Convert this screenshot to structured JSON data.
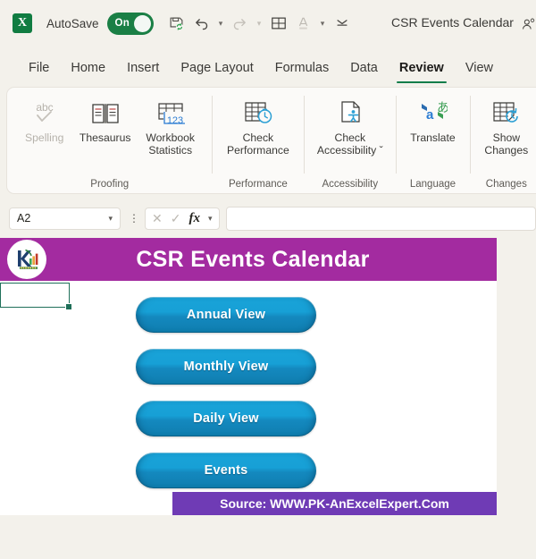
{
  "titlebar": {
    "app_icon": "excel-icon",
    "app_letter": "X",
    "autosave_label": "AutoSave",
    "autosave_state": "On",
    "doc_title": "CSR Events Calendar",
    "qat": [
      {
        "name": "save-icon",
        "label": "Save"
      },
      {
        "name": "undo-icon",
        "label": "Undo"
      },
      {
        "name": "redo-icon",
        "label": "Redo"
      },
      {
        "name": "borders-icon",
        "label": "Borders"
      },
      {
        "name": "font-color-icon",
        "label": "Font Color"
      },
      {
        "name": "customize-quick-access-toolbar-icon",
        "label": "Customize Quick Access Toolbar"
      }
    ],
    "share_icon": "share-person-icon"
  },
  "tabs": [
    {
      "label": "File",
      "active": false
    },
    {
      "label": "Home",
      "active": false
    },
    {
      "label": "Insert",
      "active": false
    },
    {
      "label": "Page Layout",
      "active": false
    },
    {
      "label": "Formulas",
      "active": false
    },
    {
      "label": "Data",
      "active": false
    },
    {
      "label": "Review",
      "active": true
    },
    {
      "label": "View",
      "active": false
    }
  ],
  "ribbon": {
    "groups": [
      {
        "name": "Proofing",
        "buttons": [
          {
            "label": "Spelling",
            "icon": "spelling-abc-check-icon",
            "disabled": true
          },
          {
            "label": "Thesaurus",
            "icon": "thesaurus-book-icon",
            "disabled": false
          },
          {
            "label": "Workbook Statistics",
            "icon": "workbook-statistics-icon",
            "disabled": false
          }
        ]
      },
      {
        "name": "Performance",
        "buttons": [
          {
            "label": "Check Performance",
            "icon": "check-performance-icon",
            "disabled": false
          }
        ]
      },
      {
        "name": "Accessibility",
        "buttons": [
          {
            "label": "Check Accessibility ˇ",
            "icon": "check-accessibility-icon",
            "disabled": false
          }
        ]
      },
      {
        "name": "Language",
        "buttons": [
          {
            "label": "Translate",
            "icon": "translate-icon",
            "disabled": false
          }
        ]
      },
      {
        "name": "Changes",
        "buttons": [
          {
            "label": "Show Changes",
            "icon": "show-changes-icon",
            "disabled": false
          }
        ]
      }
    ]
  },
  "formula_bar": {
    "name_box_value": "A2",
    "cancel_icon": "cancel-x-icon",
    "enter_icon": "enter-check-icon",
    "fx_label": "fx",
    "formula_value": "",
    "formula_placeholder": ""
  },
  "sheet": {
    "banner": {
      "title": "CSR Events Calendar",
      "background": "#A32BA0",
      "logo": "pk-an-excel-expert-logo"
    },
    "selected_cell": "A2",
    "nav_buttons": [
      {
        "label": "Annual View"
      },
      {
        "label": "Monthly View"
      },
      {
        "label": "Daily View"
      },
      {
        "label": "Events"
      }
    ],
    "button_color": "#17A0D6",
    "source_text": "Source: WWW.PK-AnExcelExpert.Com",
    "source_background": "#6F3BB5"
  }
}
